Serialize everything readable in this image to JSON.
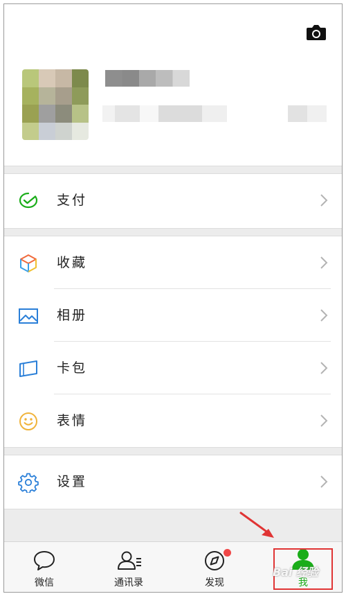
{
  "menu": {
    "pay": "支付",
    "favorites": "收藏",
    "album": "相册",
    "cards": "卡包",
    "stickers": "表情",
    "settings": "设置"
  },
  "tabbar": {
    "chats": "微信",
    "contacts": "通讯录",
    "discover": "发现",
    "me": "我"
  },
  "watermark": "Bai 经验",
  "colors": {
    "wechat_green": "#1aad19",
    "icon_blue": "#2a7fd8",
    "smile_yellow": "#f0b33a",
    "badge_red": "#f04848",
    "annotation_red": "#e03434"
  },
  "icons": {
    "profile": "camera-icon",
    "pay": "pay-check-icon",
    "favorites": "cube-icon",
    "album": "image-icon",
    "cards": "card-wallet-icon",
    "stickers": "smile-icon",
    "settings": "gear-icon",
    "chats": "chat-bubble-icon",
    "contacts": "person-list-icon",
    "discover": "compass-icon",
    "me": "person-icon"
  }
}
